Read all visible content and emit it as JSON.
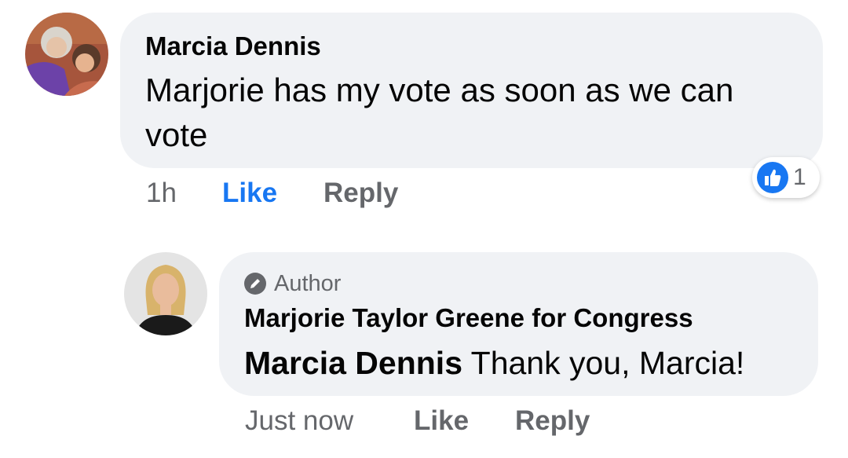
{
  "comment": {
    "author": "Marcia Dennis",
    "text_line1": "Marjorie has my vote as soon as we can",
    "text_line2": "vote",
    "time": "1h",
    "like_label": "Like",
    "reply_label": "Reply",
    "reaction_count": "1",
    "reaction_icon": "thumbs-up-icon"
  },
  "reply": {
    "badge": "Author",
    "badge_icon": "pencil-icon",
    "author": "Marjorie Taylor Greene for Congress",
    "mention": "Marcia Dennis",
    "text": "Thank you, Marcia!",
    "time": "Just now",
    "like_label": "Like",
    "reply_label": "Reply"
  },
  "colors": {
    "accent": "#1877f2",
    "bubble": "#f0f2f5",
    "muted": "#65676b"
  }
}
